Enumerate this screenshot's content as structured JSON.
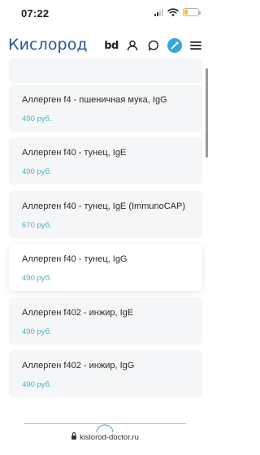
{
  "status_bar": {
    "time": "07:22",
    "battery_level": 0.25,
    "battery_color": "#f5c518",
    "icons": [
      "signal-icon",
      "wifi-icon",
      "battery-icon"
    ]
  },
  "header": {
    "logo_text": "Кислород",
    "logo_color": "#2a5597",
    "accent_color": "#58b7c8",
    "bd_label": "bd",
    "icons": [
      "bd-icon",
      "user-icon",
      "chat-icon",
      "doctor-icon",
      "menu-icon"
    ]
  },
  "products": [
    {
      "title": "Аллерген f4 - пшеничная мука, IgG",
      "price": "490 руб."
    },
    {
      "title": "Аллерген f40 - тунец, IgE",
      "price": "490 руб."
    },
    {
      "title": "Аллерген f40 - тунец, IgE (ImmunoCAP)",
      "price": "670 руб."
    },
    {
      "title": "Аллерген f40 - тунец, IgG",
      "price": "490 руб."
    },
    {
      "title": "Аллерген f402 - инжир, IgE",
      "price": "490 руб."
    },
    {
      "title": "Аллерген f402 - инжир, IgG",
      "price": "490 руб."
    }
  ],
  "price_color": "#4fb3bf",
  "browser": {
    "url": "kislorod-doctor.ru"
  }
}
